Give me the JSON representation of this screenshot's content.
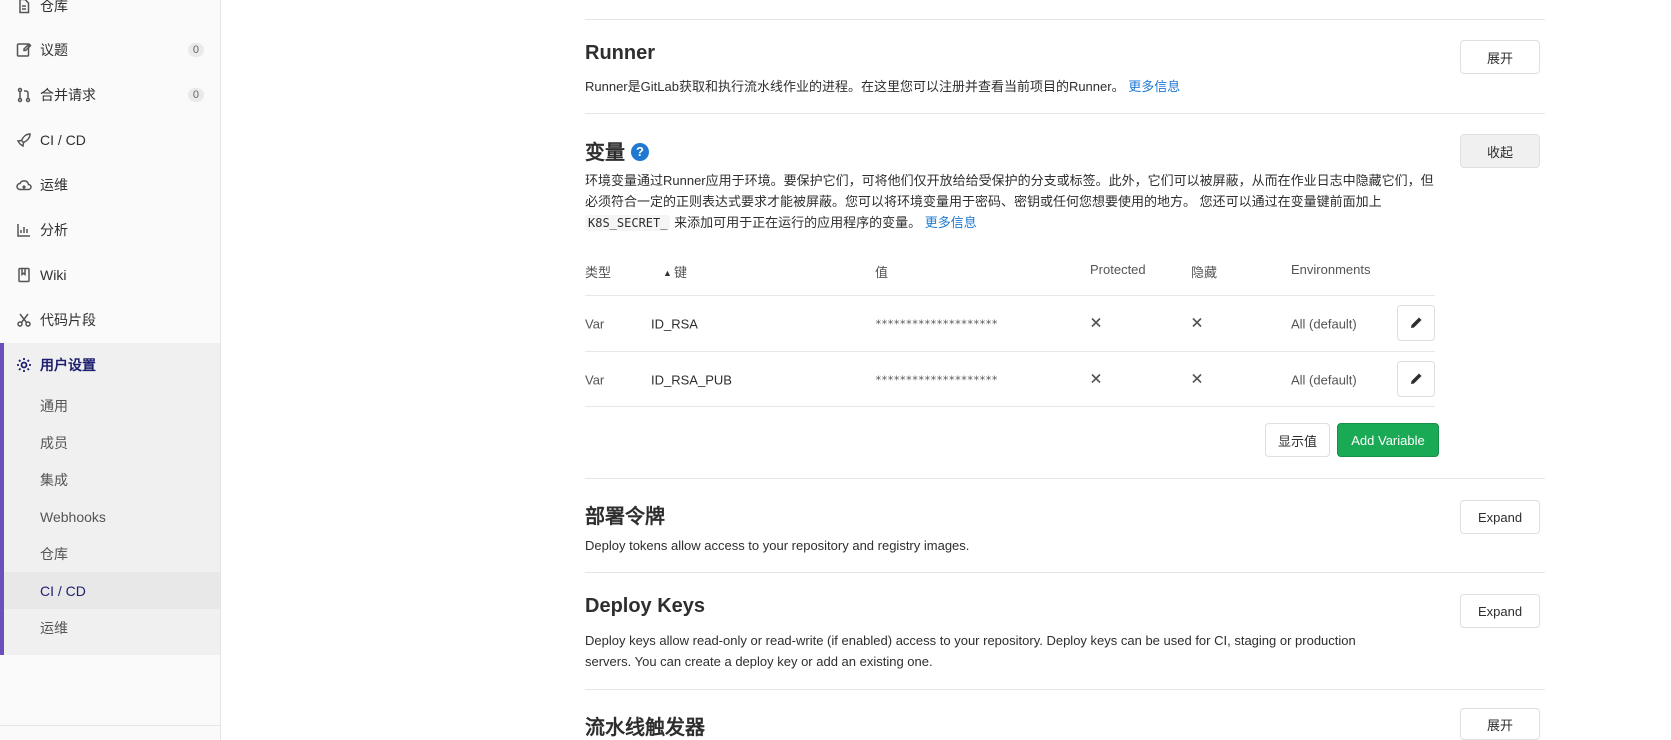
{
  "sidebar": {
    "items": [
      {
        "label": "仓库",
        "icon": "file-icon"
      },
      {
        "label": "议题",
        "icon": "issues-icon",
        "count": "0"
      },
      {
        "label": "合并请求",
        "icon": "merge-request-icon",
        "count": "0"
      },
      {
        "label": "CI / CD",
        "icon": "rocket-icon"
      },
      {
        "label": "运维",
        "icon": "cloud-icon"
      },
      {
        "label": "分析",
        "icon": "chart-icon"
      },
      {
        "label": "Wiki",
        "icon": "book-icon"
      },
      {
        "label": "代码片段",
        "icon": "scissors-icon"
      },
      {
        "label": "用户设置",
        "icon": "gear-icon"
      }
    ],
    "settings_subitems": [
      "通用",
      "成员",
      "集成",
      "Webhooks",
      "仓库",
      "CI / CD",
      "运维"
    ],
    "current_subitem": "CI / CD"
  },
  "sections": {
    "runner": {
      "title": "Runner",
      "description": "Runner是GitLab获取和执行流水线作业的进程。在这里您可以注册并查看当前项目的Runner。",
      "more_link": "更多信息",
      "button": "展开"
    },
    "variables": {
      "title": "变量",
      "help": "?",
      "description_part1": "环境变量通过Runner应用于环境。要保护它们，可将他们仅开放给给受保护的分支或标签。此外，它们可以被屏蔽，从而在作业日志中隐藏它们，但必须符合一定的正则表达式要求才能被屏蔽。您可以将环境变量用于密码、密钥或任何您想要使用的地方。 您还可以通过在变量键前面加上",
      "code": "K8S_SECRET_",
      "description_part2": "来添加可用于正在运行的应用程序的变量。",
      "more_link": "更多信息",
      "button": "收起",
      "table": {
        "headers": {
          "type": "类型",
          "key": "键",
          "value": "值",
          "protected": "Protected",
          "masked": "隐藏",
          "environments": "Environments"
        },
        "rows": [
          {
            "type": "Var",
            "key": "ID_RSA",
            "value": "********************",
            "environment": "All (default)"
          },
          {
            "type": "Var",
            "key": "ID_RSA_PUB",
            "value": "********************",
            "environment": "All (default)"
          }
        ]
      },
      "reveal_button": "显示值",
      "add_button": "Add Variable"
    },
    "deploy_tokens": {
      "title": "部署令牌",
      "description": "Deploy tokens allow access to your repository and registry images.",
      "button": "Expand"
    },
    "deploy_keys": {
      "title": "Deploy Keys",
      "description_line1": "Deploy keys allow read-only or read-write (if enabled) access to your repository. Deploy keys can be used for CI, staging or production",
      "description_line2": "servers. You can create a deploy key or add an existing one.",
      "button": "Expand"
    },
    "pipeline_triggers": {
      "title": "流水线触发器",
      "button": "展开"
    }
  },
  "colors": {
    "accent": "#6b4fbb",
    "link": "#1f78d1",
    "success": "#1aaa55"
  }
}
